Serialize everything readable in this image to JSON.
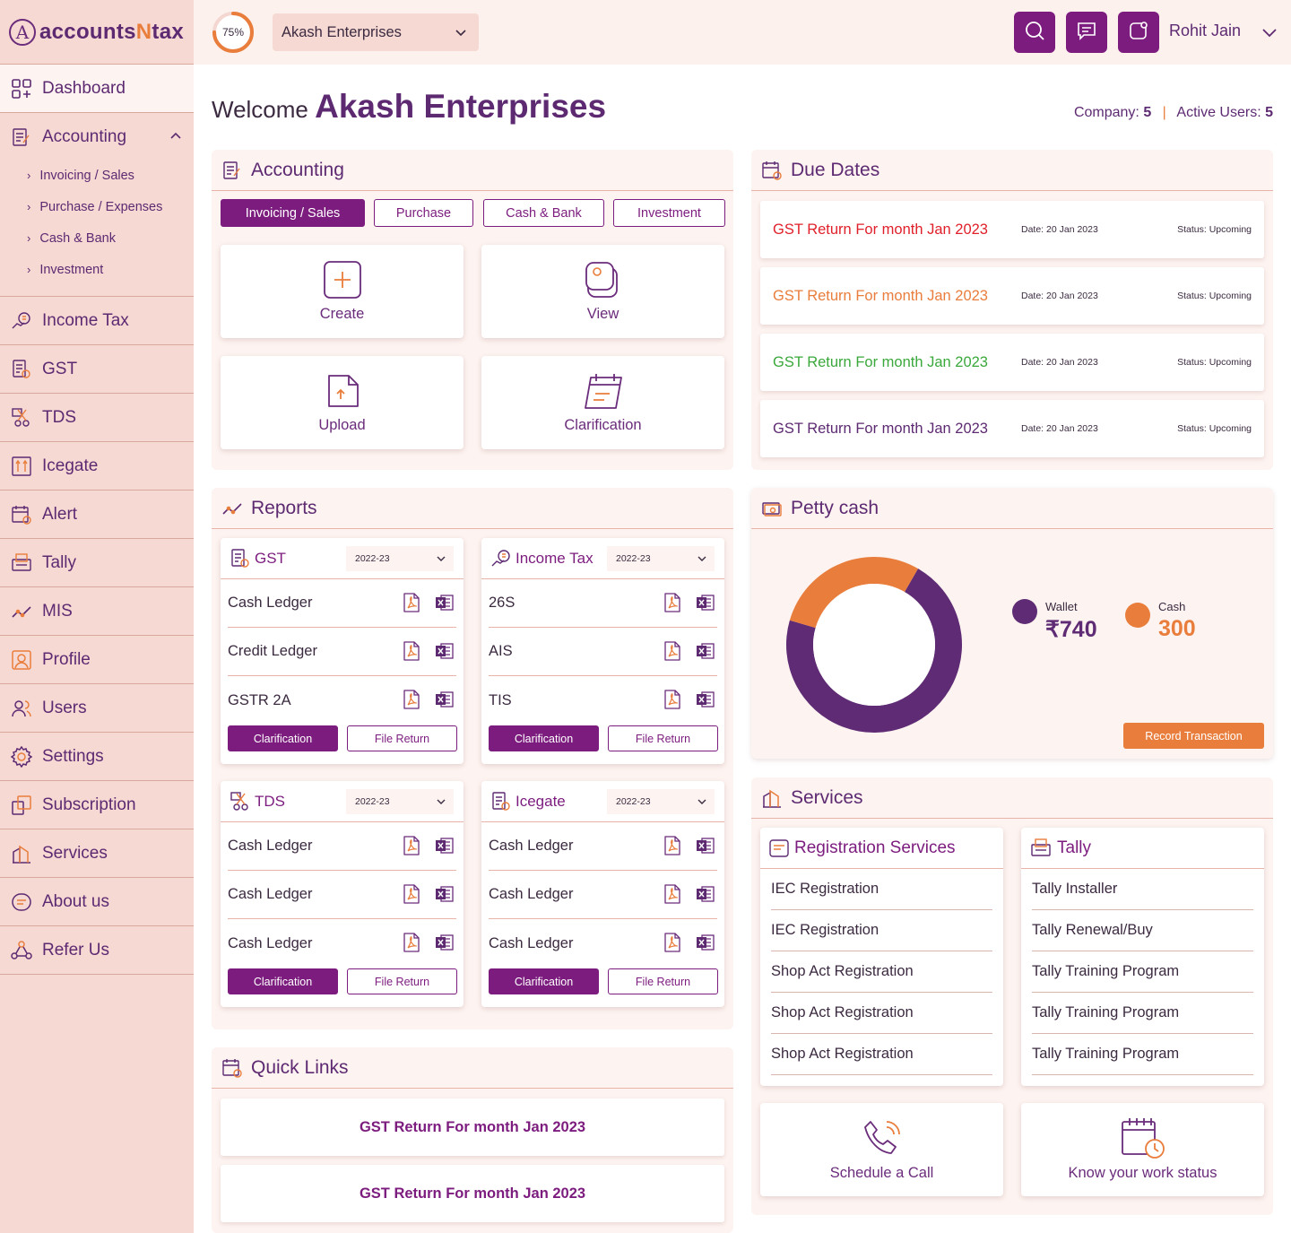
{
  "brand": {
    "prefix": "accounts",
    "highlight": "N",
    "suffix": "tax",
    "mark": "A"
  },
  "topbar": {
    "progress_label": "75%",
    "progress_value": 0.75,
    "company": "Akash Enterprises",
    "user": "Rohit Jain"
  },
  "sidebar": {
    "items": [
      {
        "label": "Dashboard",
        "icon": "dashboard-icon"
      },
      {
        "label": "Accounting",
        "icon": "accounting-icon"
      },
      {
        "label": "Income Tax",
        "icon": "income-tax-icon"
      },
      {
        "label": "GST",
        "icon": "gst-icon"
      },
      {
        "label": "TDS",
        "icon": "tds-icon"
      },
      {
        "label": "Icegate",
        "icon": "icegate-icon"
      },
      {
        "label": "Alert",
        "icon": "calendar-icon"
      },
      {
        "label": "Tally",
        "icon": "tally-icon"
      },
      {
        "label": "MIS",
        "icon": "trend-icon"
      },
      {
        "label": "Profile",
        "icon": "profile-icon"
      },
      {
        "label": "Users",
        "icon": "users-icon"
      },
      {
        "label": "Settings",
        "icon": "gear-icon"
      },
      {
        "label": "Subscription",
        "icon": "subscription-icon"
      },
      {
        "label": "Services",
        "icon": "services-icon"
      },
      {
        "label": "About us",
        "icon": "about-icon"
      },
      {
        "label": "Refer Us",
        "icon": "refer-icon"
      }
    ],
    "accounting_sub": [
      "Invoicing / Sales",
      "Purchase / Expenses",
      "Cash & Bank",
      "Investment"
    ]
  },
  "welcome": {
    "prefix": "Welcome",
    "name": "Akash Enterprises"
  },
  "stats": {
    "company_label": "Company:",
    "company_value": "5",
    "users_label": "Active Users:",
    "users_value": "5"
  },
  "accounting": {
    "title": "Accounting",
    "tabs": [
      "Invoicing / Sales",
      "Purchase",
      "Cash & Bank",
      "Investment"
    ],
    "tiles": [
      "Create",
      "View",
      "Upload",
      "Clarification"
    ]
  },
  "due_dates": {
    "title": "Due Dates",
    "rows": [
      {
        "title": "GST Return For month Jan 2023",
        "date": "Date: 20 Jan 2023",
        "status": "Status: Upcoming",
        "color": "#e0202a"
      },
      {
        "title": "GST Return For month Jan 2023",
        "date": "Date: 20 Jan 2023",
        "status": "Status: Upcoming",
        "color": "#e97d3c"
      },
      {
        "title": "GST Return For month Jan 2023",
        "date": "Date: 20 Jan 2023",
        "status": "Status: Upcoming",
        "color": "#3aa83a"
      },
      {
        "title": "GST Return For month Jan 2023",
        "date": "Date: 20 Jan 2023",
        "status": "Status: Upcoming",
        "color": "#5d2a72"
      }
    ]
  },
  "reports": {
    "title": "Reports",
    "cards": [
      {
        "title": "GST",
        "year": "2022-23",
        "rows": [
          "Cash Ledger",
          "Credit Ledger",
          "GSTR 2A"
        ],
        "btn1": "Clarification",
        "btn2": "File Return"
      },
      {
        "title": "Income Tax",
        "year": "2022-23",
        "rows": [
          "26S",
          "AIS",
          "TIS"
        ],
        "btn1": "Clarification",
        "btn2": "File Return"
      },
      {
        "title": "TDS",
        "year": "2022-23",
        "rows": [
          "Cash Ledger",
          "Cash Ledger",
          "Cash Ledger"
        ],
        "btn1": "Clarification",
        "btn2": "File Return"
      },
      {
        "title": "Icegate",
        "year": "2022-23",
        "rows": [
          "Cash Ledger",
          "Cash Ledger",
          "Cash Ledger"
        ],
        "btn1": "Clarification",
        "btn2": "File Return"
      }
    ]
  },
  "petty_cash": {
    "title": "Petty cash",
    "wallet_label": "Wallet",
    "wallet_value": "₹740",
    "cash_label": "Cash",
    "cash_value": "300",
    "button": "Record Transaction",
    "colors": {
      "wallet": "#5e2b74",
      "cash": "#e97d3c"
    }
  },
  "chart_data": {
    "type": "pie",
    "categories": [
      "Wallet",
      "Cash"
    ],
    "values": [
      740,
      300
    ]
  },
  "services": {
    "title": "Services",
    "registration": {
      "title": "Registration Services",
      "rows": [
        "IEC Registration",
        "IEC Registration",
        "Shop Act Registration",
        "Shop Act Registration",
        "Shop Act Registration"
      ]
    },
    "tally": {
      "title": "Tally",
      "rows": [
        "Tally Installer",
        "Tally Renewal/Buy",
        "Tally Training Program",
        "Tally Training Program",
        "Tally Training Program"
      ]
    },
    "tiles": [
      "Schedule a Call",
      "Know your work status"
    ]
  },
  "quick_links": {
    "title": "Quick Links",
    "rows": [
      "GST Return For month Jan 2023",
      "GST Return For month Jan 2023"
    ]
  }
}
